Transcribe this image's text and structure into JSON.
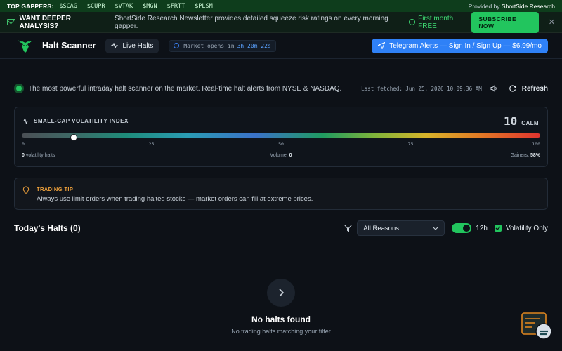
{
  "ticker": {
    "label": "TOP GAPPERS:",
    "symbols": [
      "$SCAG",
      "$CUPR",
      "$VTAK",
      "$MGN",
      "$FRTT",
      "$PLSM"
    ],
    "provided_prefix": "Provided by ",
    "provided_by": "ShortSide Research"
  },
  "promo": {
    "headline": "WANT DEEPER ANALYSIS?",
    "description": "ShortSide Research Newsletter provides detailed squeeze risk ratings on every morning gapper.",
    "offer": "First month FREE",
    "subscribe_label": "SUBSCRIBE NOW",
    "close_label": "✕"
  },
  "header": {
    "brand": "Halt Scanner",
    "live_label": "Live Halts",
    "market_prefix": "Market opens in",
    "market_time": "3h 20m 22s",
    "telegram_label": "Telegram Alerts — Sign In / Sign Up — $6.99/mo"
  },
  "intro": {
    "tagline": "The most powerful intraday halt scanner on the market. Real-time halt alerts from NYSE & NASDAQ.",
    "last_fetched": "Last fetched: Jun 25, 2026 10:09:36 AM",
    "refresh_label": "Refresh"
  },
  "volatility": {
    "title": "SMALL-CAP VOLATILITY INDEX",
    "score": "10",
    "level": "CALM",
    "value": 10,
    "ticks": [
      "0",
      "25",
      "50",
      "75",
      "100"
    ],
    "halts_value": "0",
    "halts_label": " volatility halts",
    "volume_label": "Volume: ",
    "volume_value": "0",
    "gainers_label": "Gainers: ",
    "gainers_value": "58%"
  },
  "tip": {
    "title": "TRADING TIP",
    "text": "Always use limit orders when trading halted stocks — market orders can fill at extreme prices."
  },
  "halts": {
    "heading": "Today's Halts (0)",
    "reason_selected": "All Reasons",
    "hours_label": "12h",
    "volatility_only_label": "Volatility Only"
  },
  "empty": {
    "title": "No halts found",
    "subtitle": "No trading halts matching your filter"
  },
  "colors": {
    "accent_green": "#22c55e",
    "telegram_blue": "#2f81f7",
    "tip_orange": "#f0a23b",
    "background": "#0d1117"
  }
}
